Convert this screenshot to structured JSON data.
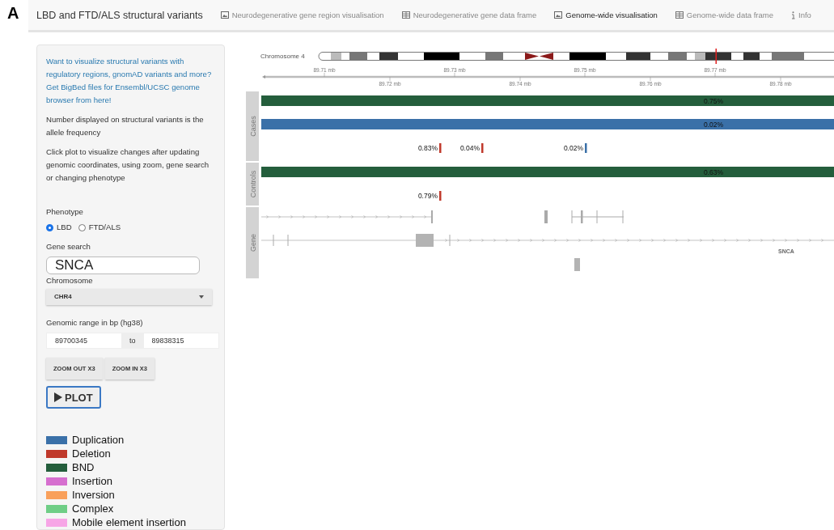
{
  "figure_label": "A",
  "navbar": {
    "brand": "LBD and FTD/ALS structural variants",
    "tabs": [
      {
        "label": "Neurodegenerative gene region visualisation",
        "kind": "image",
        "selected": false
      },
      {
        "label": "Neurodegenerative gene data frame",
        "kind": "table",
        "selected": false
      },
      {
        "label": "Genome-wide visualisation",
        "kind": "image",
        "selected": true
      },
      {
        "label": "Genome-wide data frame",
        "kind": "table",
        "selected": false
      },
      {
        "label": "Info",
        "kind": "info",
        "selected": false
      }
    ]
  },
  "sidebar": {
    "link": "Want to visualize structural variants with regulatory regions, gnomAD variants and more? Get BigBed files for Ensembl/UCSC genome browser from here!",
    "notes": [
      "Number displayed on structural variants is the allele frequency",
      "Click plot to visualize changes after updating genomic coordinates, using zoom, gene search or changing phenotype"
    ],
    "phenotype": {
      "label": "Phenotype",
      "options": [
        {
          "label": "LBD",
          "selected": true
        },
        {
          "label": "FTD/ALS",
          "selected": false
        }
      ]
    },
    "gene_search": {
      "label": "Gene search",
      "value": "SNCA"
    },
    "chromosome": {
      "label": "Chromosome",
      "value": "CHR4"
    },
    "range": {
      "label": "Genomic range in bp (hg38)",
      "start": "89700345",
      "separator": "to",
      "end": "89838315"
    },
    "zoom_buttons": [
      "ZOOM OUT X3",
      "ZOOM IN X3"
    ],
    "plot_button": "PLOT",
    "legend": [
      {
        "label": "Duplication",
        "color": "#3a70a8"
      },
      {
        "label": "Deletion",
        "color": "#c0392b"
      },
      {
        "label": "BND",
        "color": "#245e3c"
      },
      {
        "label": "Insertion",
        "color": "#d66fcf"
      },
      {
        "label": "Inversion",
        "color": "#f9a05b"
      },
      {
        "label": "Complex",
        "color": "#6fce86"
      },
      {
        "label": "Mobile element insertion",
        "color": "#f7a5e6"
      }
    ]
  },
  "plot": {
    "chromosome_label": "Chromosome 4",
    "ticks_upper": [
      "89.71 mb",
      "89.73 mb",
      "89.75 mb",
      "89.77 mb"
    ],
    "ticks_lower": [
      "89.72 mb",
      "89.74 mb",
      "89.76 mb",
      "89.78 mb"
    ],
    "tracks": [
      {
        "label": "Cases",
        "variants": [
          {
            "kind": "bar",
            "color": "#245e3c",
            "label": "0.75%"
          },
          {
            "kind": "bar",
            "color": "#3a70a8",
            "label": "0.02%"
          },
          {
            "kind": "tick",
            "color": "#c0392b",
            "label": "0.83%"
          },
          {
            "kind": "tick",
            "color": "#c0392b",
            "label": "0.04%"
          },
          {
            "kind": "tick",
            "color": "#3a70a8",
            "label": "0.02%"
          }
        ]
      },
      {
        "label": "Controls",
        "variants": [
          {
            "kind": "bar",
            "color": "#245e3c",
            "label": "0.63%"
          },
          {
            "kind": "tick",
            "color": "#c0392b",
            "label": "0.79%"
          }
        ]
      }
    ],
    "gene_track": {
      "label": "Gene",
      "gene": "SNCA"
    }
  }
}
